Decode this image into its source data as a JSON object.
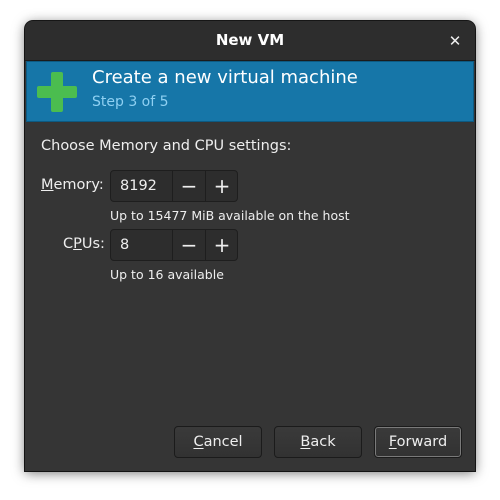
{
  "window": {
    "title": "New VM",
    "close_glyph": "✕"
  },
  "banner": {
    "icon": "green-plus-icon",
    "title": "Create a new virtual machine",
    "subtitle": "Step 3 of 5"
  },
  "form": {
    "section_label": "Choose Memory and CPU settings:",
    "memory": {
      "label": "Memory:",
      "value": "8192",
      "hint": "Up to 15477 MiB available on the host"
    },
    "cpus": {
      "label": "CPUs:",
      "value": "8",
      "hint": "Up to 16 available"
    }
  },
  "buttons": {
    "cancel": "Cancel",
    "back": "Back",
    "forward": "Forward"
  },
  "glyphs": {
    "minus": "−",
    "plus": "+"
  },
  "colors": {
    "window_bg": "#353535",
    "banner_bg": "#1676a8",
    "banner_subtitle": "#8fd0f2",
    "plus_icon": "#4bbd4f"
  }
}
